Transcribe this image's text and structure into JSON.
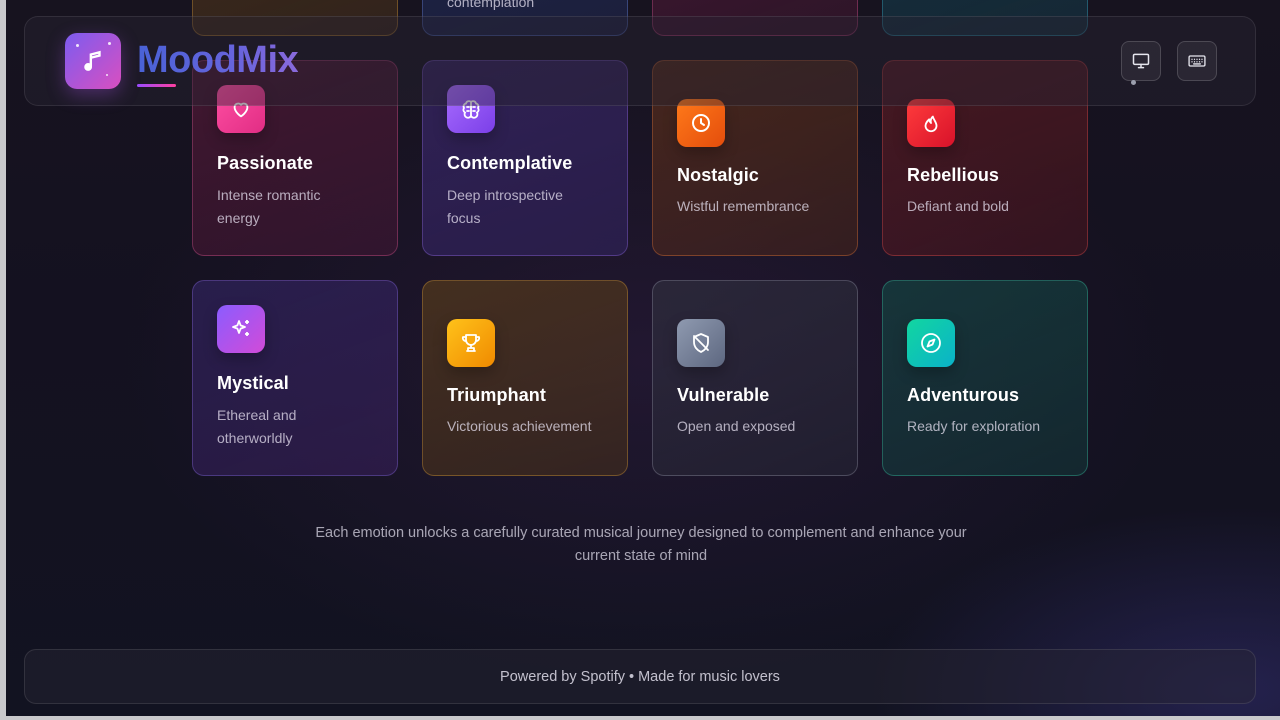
{
  "app": {
    "name": "MoodMix",
    "accent_colors": [
      "#7c5cf0",
      "#d94fc0",
      "#4c66e0"
    ]
  },
  "header": {
    "logo_icon": "music-note-icon",
    "display_button_icon": "monitor-icon",
    "keyboard_button_icon": "keyboard-icon"
  },
  "top_partial_cards": [
    {
      "text": "",
      "color": "#f08a00"
    },
    {
      "text": "contemplation",
      "color": "#4c66e0"
    },
    {
      "text": "",
      "color": "#e12d84"
    },
    {
      "text": "",
      "color": "#0ab2c9"
    }
  ],
  "moods": [
    {
      "title": "Passionate",
      "description": "Intense romantic energy",
      "icon": "heart-icon",
      "color": "#e12d84"
    },
    {
      "title": "Contemplative",
      "description": "Deep introspective focus",
      "icon": "brain-icon",
      "color": "#7b3fe8"
    },
    {
      "title": "Nostalgic",
      "description": "Wistful remembrance",
      "icon": "clock-icon",
      "color": "#e44d0c"
    },
    {
      "title": "Rebellious",
      "description": "Defiant and bold",
      "icon": "flame-icon",
      "color": "#d8122a"
    },
    {
      "title": "Mystical",
      "description": "Ethereal and otherworldly",
      "icon": "sparkles-icon",
      "color": "#8b5cff"
    },
    {
      "title": "Triumphant",
      "description": "Victorious achievement",
      "icon": "trophy-icon",
      "color": "#f08a00"
    },
    {
      "title": "Vulnerable",
      "description": "Open and exposed",
      "icon": "shield-off-icon",
      "color": "#5d6780"
    },
    {
      "title": "Adventurous",
      "description": "Ready for exploration",
      "icon": "compass-icon",
      "color": "#0ab2c9"
    }
  ],
  "note": "Each emotion unlocks a carefully curated musical journey designed to complement and enhance your current state of mind",
  "footer": "Powered by Spotify • Made for music lovers"
}
